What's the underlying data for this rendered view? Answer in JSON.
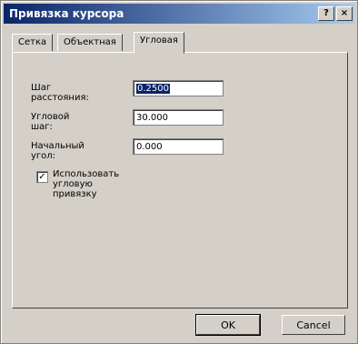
{
  "window": {
    "title": "Привязка курсора",
    "help_button": "?",
    "close_button": "×"
  },
  "tabs": [
    {
      "label": "Сетка"
    },
    {
      "label": "Объектная"
    },
    {
      "label": "Угловая"
    }
  ],
  "fields": [
    {
      "label": "Шаг расстояния:",
      "value": "0.2500"
    },
    {
      "label": "Угловой шаг:",
      "value": "30.000"
    },
    {
      "label": "Начальный угол:",
      "value": "0.000"
    }
  ],
  "checkbox": {
    "label": "Использовать угловую привязку",
    "checked": "✓"
  },
  "buttons": {
    "ok": "OK",
    "cancel": "Cancel"
  }
}
